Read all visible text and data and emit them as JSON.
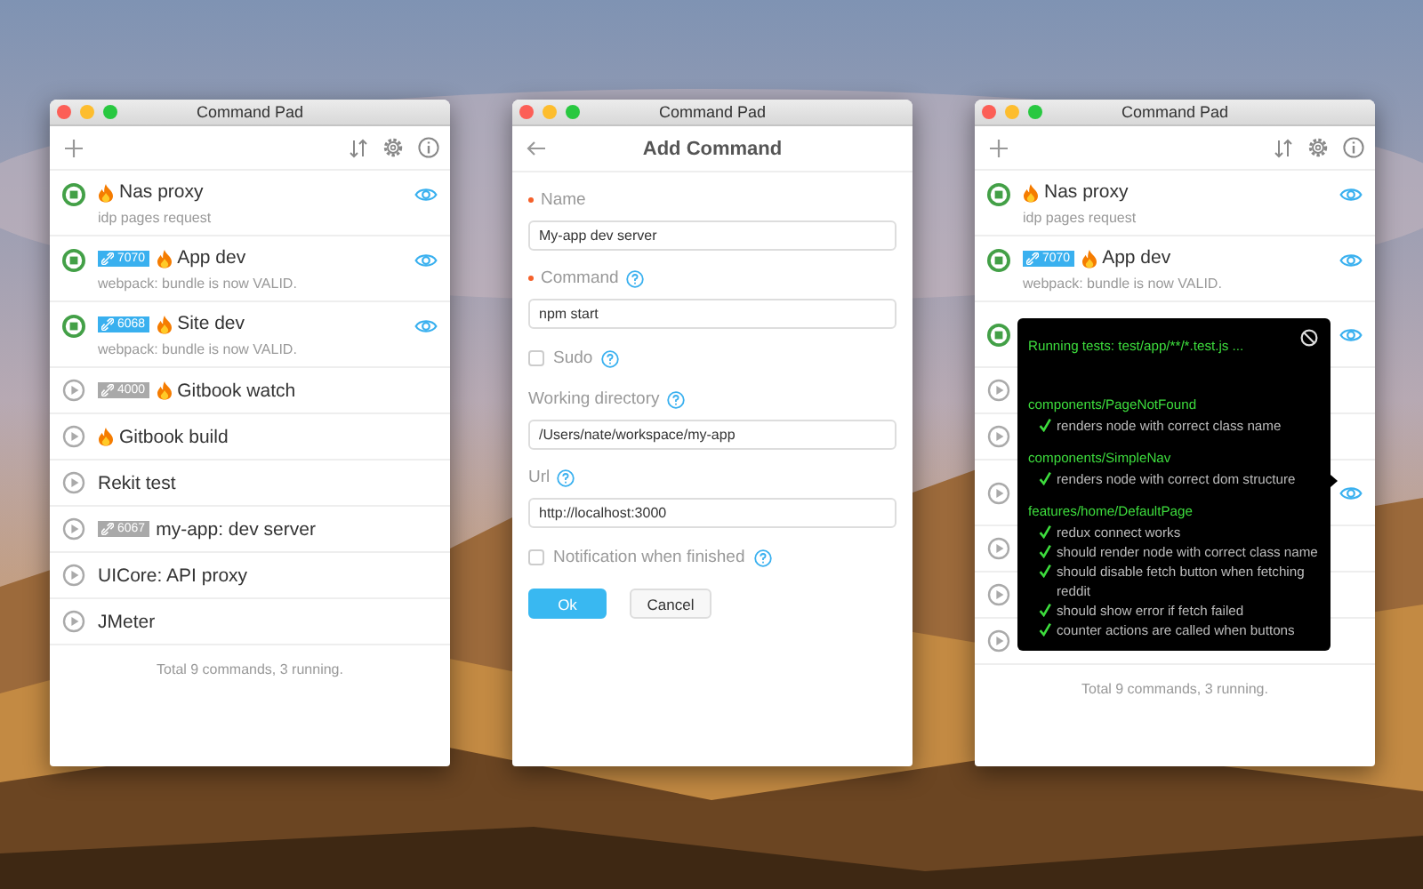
{
  "windows": [
    {
      "kind": "list",
      "title": "Command Pad",
      "commands": [
        {
          "name": "Nas proxy",
          "detail": "idp pages request",
          "running": true,
          "flame": true,
          "watching": true
        },
        {
          "name": "App dev",
          "detail": "webpack: bundle is now VALID.",
          "port": "7070",
          "port_active": true,
          "running": true,
          "flame": true,
          "watching": true
        },
        {
          "name": "Site dev",
          "detail": "webpack: bundle is now VALID.",
          "port": "6068",
          "port_active": true,
          "running": true,
          "flame": true,
          "watching": true
        },
        {
          "name": "Gitbook watch",
          "port": "4000",
          "port_active": false,
          "running": false,
          "flame": true,
          "watching": false
        },
        {
          "name": "Gitbook build",
          "running": false,
          "flame": true,
          "watching": false
        },
        {
          "name": "Rekit test",
          "running": false,
          "flame": false,
          "watching": false
        },
        {
          "name": "my-app: dev server",
          "port": "6067",
          "port_active": false,
          "running": false,
          "flame": false,
          "watching": false
        },
        {
          "name": "UICore: API proxy",
          "running": false,
          "flame": false,
          "watching": false
        },
        {
          "name": "JMeter",
          "running": false,
          "flame": false,
          "watching": false
        }
      ],
      "footer": "Total 9 commands, 3 running."
    },
    {
      "kind": "form",
      "title": "Command Pad",
      "heading": "Add Command",
      "fields": [
        {
          "kind": "text",
          "label": "Name",
          "required": true,
          "help": false,
          "value": "My-app dev server"
        },
        {
          "kind": "text",
          "label": "Command",
          "required": true,
          "help": true,
          "value": "npm start"
        },
        {
          "kind": "checkbox",
          "label": "Sudo",
          "checked": false,
          "help": true
        },
        {
          "kind": "text",
          "label": "Working directory",
          "required": false,
          "help": true,
          "value": "/Users/nate/workspace/my-app"
        },
        {
          "kind": "text",
          "label": "Url",
          "required": false,
          "help": true,
          "value": "http://localhost:3000"
        },
        {
          "kind": "checkbox",
          "label": "Notification when finished",
          "checked": false,
          "help": true
        }
      ],
      "buttons": [
        {
          "label": "Ok",
          "kind": "primary"
        },
        {
          "label": "Cancel",
          "kind": "default"
        }
      ]
    },
    {
      "kind": "list",
      "title": "Command Pad",
      "commands": [
        {
          "name": "Nas proxy",
          "detail": "idp pages request",
          "running": true,
          "flame": true,
          "watching": true
        },
        {
          "name": "App dev",
          "detail": "webpack: bundle is now VALID.",
          "port": "7070",
          "port_active": true,
          "running": true,
          "flame": true,
          "watching": true
        },
        {
          "running": true,
          "flame": false,
          "watching": true,
          "tall": true
        },
        {
          "running": false,
          "flame": false,
          "watching": false
        },
        {
          "running": false,
          "flame": false,
          "watching": false
        },
        {
          "running": false,
          "flame": false,
          "watching": true,
          "tall": true
        },
        {
          "running": false,
          "flame": false,
          "watching": false
        },
        {
          "running": false,
          "flame": false,
          "watching": false
        },
        {
          "running": false,
          "flame": false,
          "watching": false
        }
      ],
      "footer": "Total 9 commands, 3 running.",
      "output": {
        "status": "Running tests: test/app/**/*.test.js ...",
        "suites": [
          {
            "name": "components/PageNotFound",
            "tests": [
              "renders node with correct class name"
            ]
          },
          {
            "name": "components/SimpleNav",
            "tests": [
              "renders node with correct dom structure"
            ]
          },
          {
            "name": "features/home/DefaultPage",
            "tests": [
              "redux connect works",
              "should render node with correct class name",
              "should disable fetch button when fetching reddit",
              "should show error if fetch failed",
              "counter actions are called when buttons"
            ]
          }
        ]
      }
    }
  ]
}
